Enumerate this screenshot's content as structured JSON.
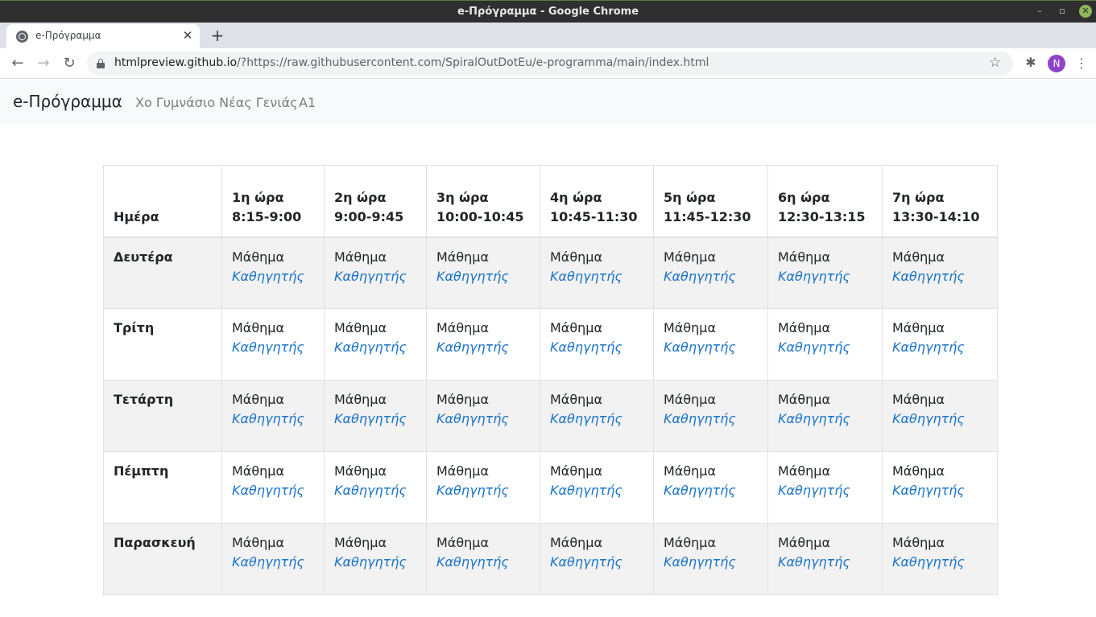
{
  "window": {
    "title": "e-Πρόγραμμα - Google Chrome",
    "minimize_glyph": "–",
    "maximize_glyph": "▫",
    "close_glyph": "✕"
  },
  "browser": {
    "tab_title": "e-Πρόγραμμα",
    "tab_close_glyph": "✕",
    "new_tab_glyph": "+",
    "back_glyph": "←",
    "forward_glyph": "→",
    "reload_glyph": "↻",
    "url_host": "htmlpreview.github.io",
    "url_rest": "/?https://raw.githubusercontent.com/SpiralOutDotEu/e-programma/main/index.html",
    "bookmark_glyph": "☆",
    "extensions_glyph": "✱",
    "profile_initial": "N",
    "menu_glyph": "⋮",
    "icons": {
      "favicon": "globe-icon",
      "lock": "lock-icon",
      "bookmark": "star-icon",
      "extensions": "puzzle-icon",
      "menu": "kebab-menu-icon"
    },
    "colors": {
      "profile": "#8e44c8",
      "accent_link": "#1a73c8"
    }
  },
  "navbar": {
    "brand": "e-Πρόγραμμα",
    "school": "Χο Γυμνάσιο Νέας Γενιάς",
    "class": "Α1"
  },
  "timetable": {
    "day_header": "Ημέρα",
    "periods": [
      {
        "label": "1η ώρα",
        "time": "8:15-9:00"
      },
      {
        "label": "2η ώρα",
        "time": "9:00-9:45"
      },
      {
        "label": "3η ώρα",
        "time": "10:00-10:45"
      },
      {
        "label": "4η ώρα",
        "time": "10:45-11:30"
      },
      {
        "label": "5η ώρα",
        "time": "11:45-12:30"
      },
      {
        "label": "6η ώρα",
        "time": "12:30-13:15"
      },
      {
        "label": "7η ώρα",
        "time": "13:30-14:10"
      }
    ],
    "days": [
      {
        "name": "Δευτέρα",
        "slots": [
          {
            "subject": "Μάθημα",
            "teacher": "Καθηγητής"
          },
          {
            "subject": "Μάθημα",
            "teacher": "Καθηγητής"
          },
          {
            "subject": "Μάθημα",
            "teacher": "Καθηγητής"
          },
          {
            "subject": "Μάθημα",
            "teacher": "Καθηγητής"
          },
          {
            "subject": "Μάθημα",
            "teacher": "Καθηγητής"
          },
          {
            "subject": "Μάθημα",
            "teacher": "Καθηγητής"
          },
          {
            "subject": "Μάθημα",
            "teacher": "Καθηγητής"
          }
        ]
      },
      {
        "name": "Τρίτη",
        "slots": [
          {
            "subject": "Μάθημα",
            "teacher": "Καθηγητής"
          },
          {
            "subject": "Μάθημα",
            "teacher": "Καθηγητής"
          },
          {
            "subject": "Μάθημα",
            "teacher": "Καθηγητής"
          },
          {
            "subject": "Μάθημα",
            "teacher": "Καθηγητής"
          },
          {
            "subject": "Μάθημα",
            "teacher": "Καθηγητής"
          },
          {
            "subject": "Μάθημα",
            "teacher": "Καθηγητής"
          },
          {
            "subject": "Μάθημα",
            "teacher": "Καθηγητής"
          }
        ]
      },
      {
        "name": "Τετάρτη",
        "slots": [
          {
            "subject": "Μάθημα",
            "teacher": "Καθηγητής"
          },
          {
            "subject": "Μάθημα",
            "teacher": "Καθηγητής"
          },
          {
            "subject": "Μάθημα",
            "teacher": "Καθηγητής"
          },
          {
            "subject": "Μάθημα",
            "teacher": "Καθηγητής"
          },
          {
            "subject": "Μάθημα",
            "teacher": "Καθηγητής"
          },
          {
            "subject": "Μάθημα",
            "teacher": "Καθηγητής"
          },
          {
            "subject": "Μάθημα",
            "teacher": "Καθηγητής"
          }
        ]
      },
      {
        "name": "Πέμπτη",
        "slots": [
          {
            "subject": "Μάθημα",
            "teacher": "Καθηγητής"
          },
          {
            "subject": "Μάθημα",
            "teacher": "Καθηγητής"
          },
          {
            "subject": "Μάθημα",
            "teacher": "Καθηγητής"
          },
          {
            "subject": "Μάθημα",
            "teacher": "Καθηγητής"
          },
          {
            "subject": "Μάθημα",
            "teacher": "Καθηγητής"
          },
          {
            "subject": "Μάθημα",
            "teacher": "Καθηγητής"
          },
          {
            "subject": "Μάθημα",
            "teacher": "Καθηγητής"
          }
        ]
      },
      {
        "name": "Παρασκευή",
        "slots": [
          {
            "subject": "Μάθημα",
            "teacher": "Καθηγητής"
          },
          {
            "subject": "Μάθημα",
            "teacher": "Καθηγητής"
          },
          {
            "subject": "Μάθημα",
            "teacher": "Καθηγητής"
          },
          {
            "subject": "Μάθημα",
            "teacher": "Καθηγητής"
          },
          {
            "subject": "Μάθημα",
            "teacher": "Καθηγητής"
          },
          {
            "subject": "Μάθημα",
            "teacher": "Καθηγητής"
          },
          {
            "subject": "Μάθημα",
            "teacher": "Καθηγητής"
          }
        ]
      }
    ]
  }
}
